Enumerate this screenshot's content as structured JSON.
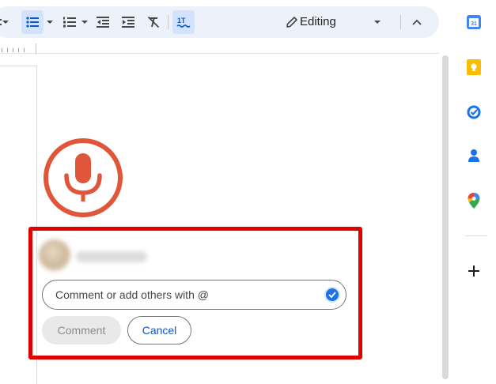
{
  "toolbar": {
    "mode_label": "Editing",
    "icons": [
      "bulleted-list-icon",
      "numbered-list-icon",
      "decrease-indent-icon",
      "increase-indent-icon",
      "clear-formatting-icon",
      "spellcheck-icon",
      "pencil-icon",
      "collapse-chevron-icon"
    ]
  },
  "comment": {
    "input_placeholder": "Comment or add others with @",
    "comment_label": "Comment",
    "cancel_label": "Cancel"
  },
  "side_panel": {
    "items": [
      "calendar-icon",
      "keep-icon",
      "tasks-icon",
      "contacts-icon",
      "maps-icon",
      "add-icon"
    ],
    "calendar_day": "31"
  },
  "colors": {
    "toolbar_bg": "#edf2fa",
    "active_button": "#d3e3fd",
    "mic": "#e0563b",
    "highlight": "#e00000",
    "cancel_text": "#0b57d0"
  }
}
